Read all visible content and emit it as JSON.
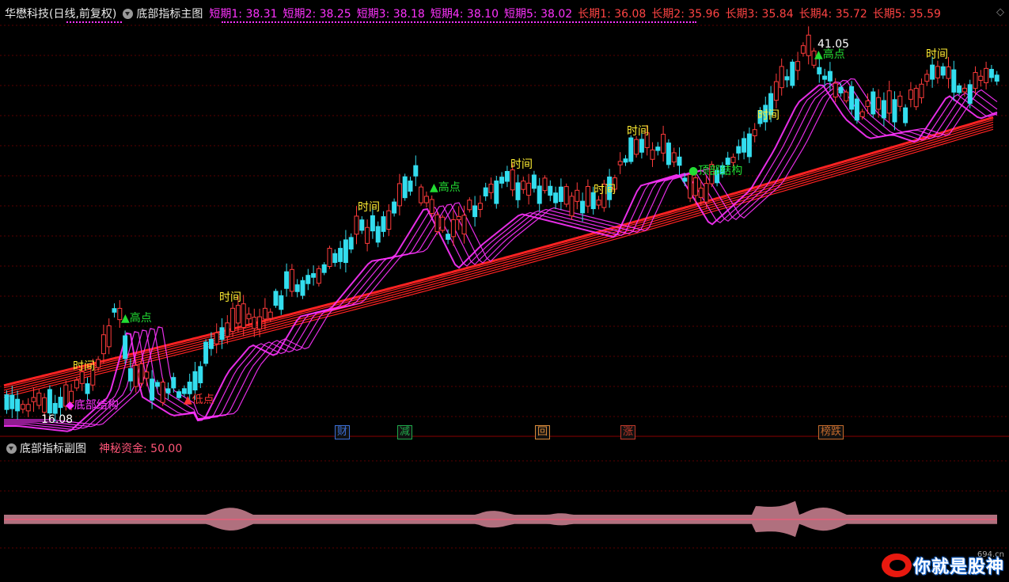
{
  "header": {
    "stock_title": "华懋科技(日线,前复权)",
    "indicator_name": "底部指标主图",
    "short_ma": [
      {
        "label": "短期1: 38.31"
      },
      {
        "label": "短期2: 38.25"
      },
      {
        "label": "短期3: 38.18"
      },
      {
        "label": "短期4: 38.10"
      },
      {
        "label": "短期5: 38.02"
      }
    ],
    "long_ma": [
      {
        "label": "长期1: 36.08"
      },
      {
        "label": "长期2: 35.96"
      },
      {
        "label": "长期3: 35.84"
      },
      {
        "label": "长期4: 35.72"
      },
      {
        "label": "长期5: 35.59"
      }
    ]
  },
  "annotations": {
    "time_label": "时间",
    "high_label": "▲高点",
    "low_label": "▲低点",
    "bottom_label": "◆底部结构",
    "top_label": "●顶部结构",
    "max_price": "41.05",
    "min_price": "16.08"
  },
  "event_tags": [
    {
      "label": "财",
      "color": "#3b6fd6"
    },
    {
      "label": "减",
      "color": "#1fa84a"
    },
    {
      "label": "回",
      "color": "#d88a3a"
    },
    {
      "label": "涨",
      "color": "#c0392b"
    },
    {
      "label": "榜跌",
      "color": "#c46a2c"
    }
  ],
  "sub": {
    "indicator_name": "底部指标副图",
    "value_label": "神秘资金: 50.00"
  },
  "watermark": {
    "site": "694.cn",
    "text": "你就是股神"
  },
  "colors": {
    "up": "#ff3b3b",
    "down": "#33ddee",
    "short_ma": "#ff33ff",
    "long_ma": "#ff2222",
    "fund_fill": "#b0707e",
    "grid": "#5a0000"
  }
}
